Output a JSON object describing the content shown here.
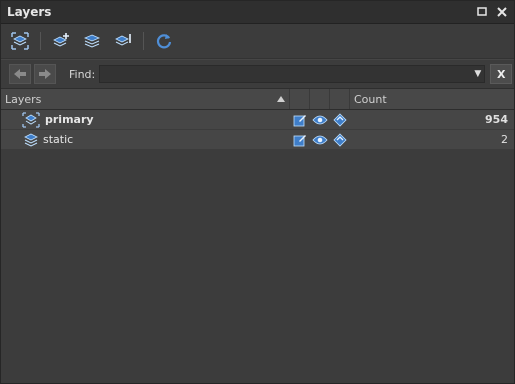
{
  "panel": {
    "title": "Layers"
  },
  "find": {
    "label": "Find:",
    "value": "",
    "clear_label": "X"
  },
  "table": {
    "columns": {
      "name": "Layers",
      "count": "Count"
    },
    "rows": [
      {
        "name": "primary",
        "count": "954",
        "active": true
      },
      {
        "name": "static",
        "count": "2",
        "active": false
      }
    ]
  },
  "colors": {
    "accent": "#4f8fd8",
    "background": "#3c3c3c"
  }
}
